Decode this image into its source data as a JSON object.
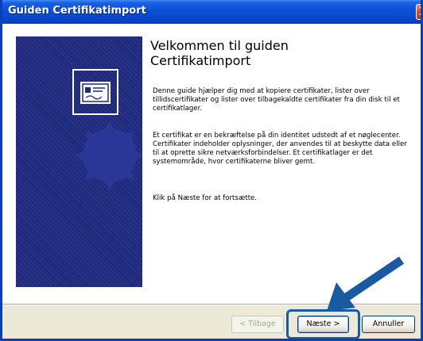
{
  "window": {
    "title": "Guiden Certifikatimport",
    "close_glyph": "X"
  },
  "wizard": {
    "heading_line1": "Velkommen til guiden",
    "heading_line2": "Certifikatimport",
    "paragraph1": "Denne guide hjælper dig med at kopiere certifikater, lister over tillidscertifikater og lister over tilbagekaldte certifikater fra din disk til et certifikatlager.",
    "paragraph2": "Et certifikat er en bekræftelse på din identitet udstedt af et nøglecenter. Certifikater indeholder oplysninger, der anvendes til at beskytte data eller til at oprette sikre netværksforbindelser. Et certifikatlager er det systemområde, hvor certifikaterne bliver gemt.",
    "paragraph3": "Klik på Næste for at fortsætte.",
    "side_icon": "certificate-icon"
  },
  "buttons": {
    "back_label": "< Tilbage",
    "next_label": "Næste >",
    "cancel_label": "Annuller"
  },
  "colors": {
    "titlebar": "#0a4fd8",
    "side_panel": "#1f2a7e",
    "annotation_arrow": "#1a5aa0"
  }
}
